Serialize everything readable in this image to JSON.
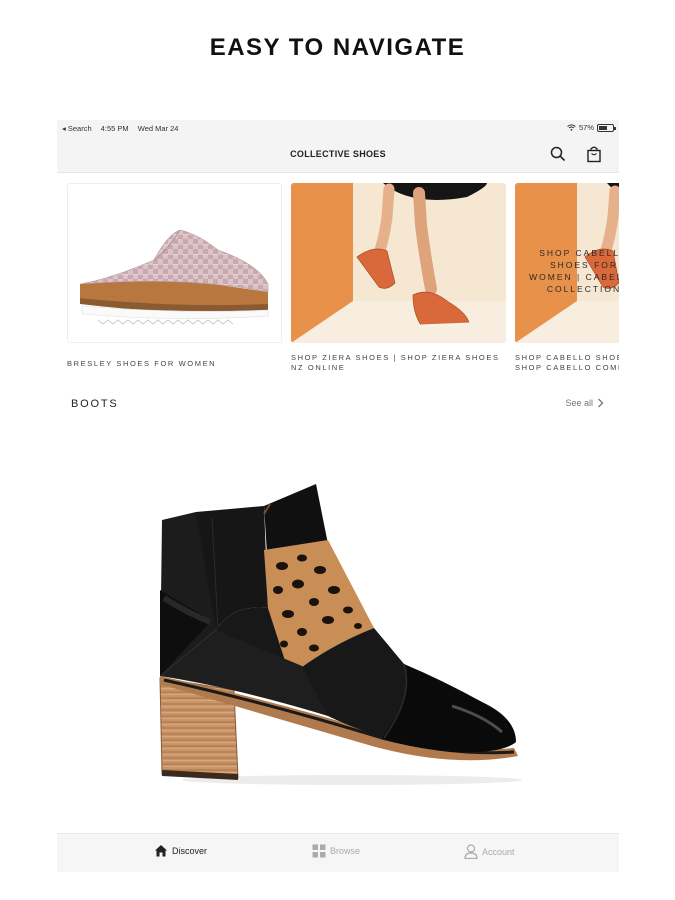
{
  "headline": "EASY TO NAVIGATE",
  "status_bar": {
    "back_label": "◂ Search",
    "time": "4:55 PM",
    "date": "Wed Mar 24",
    "battery": "57%"
  },
  "nav": {
    "title": "COLLECTIVE SHOES",
    "icons": [
      "search-icon",
      "shopping-bag-icon"
    ]
  },
  "carousel": [
    {
      "label": "BRESLEY SHOES FOR WOMEN"
    },
    {
      "label": "SHOP ZIERA SHOES | SHOP ZIERA SHOES NZ ONLINE"
    },
    {
      "label": "SHOP CABELLO SHOES FOR WOMEN | SHOP CABELLO COMFORT",
      "overlay": "SHOP CABELLO SHOES FOR WOMEN | CABELLO COLLECTION"
    }
  ],
  "section": {
    "title": "BOOTS",
    "see_all": "See all"
  },
  "tabs": [
    {
      "label": "Discover",
      "icon": "home-icon",
      "active": true
    },
    {
      "label": "Browse",
      "icon": "grid-icon",
      "active": false
    },
    {
      "label": "Account",
      "icon": "person-icon",
      "active": false
    }
  ],
  "colors": {
    "accent_orange": "#e8914a",
    "shoe_orange": "#d9693a",
    "text_dark": "#222222",
    "tab_inactive": "#aaaaaa"
  }
}
